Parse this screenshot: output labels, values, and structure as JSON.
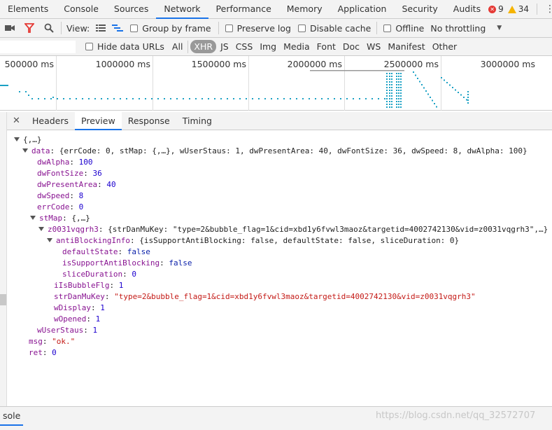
{
  "main_tabs": [
    "Elements",
    "Console",
    "Sources",
    "Network",
    "Performance",
    "Memory",
    "Application",
    "Security",
    "Audits"
  ],
  "status": {
    "errors": "9",
    "warnings": "34"
  },
  "toolbar": {
    "view_label": "View:",
    "group_by_frame": "Group by frame",
    "preserve_log": "Preserve log",
    "disable_cache": "Disable cache",
    "offline": "Offline",
    "throttling": "No throttling"
  },
  "filter": {
    "hide_data_urls": "Hide data URLs",
    "types": [
      "All",
      "XHR",
      "JS",
      "CSS",
      "Img",
      "Media",
      "Font",
      "Doc",
      "WS",
      "Manifest",
      "Other"
    ],
    "active_type": "XHR"
  },
  "overview": {
    "ticks": [
      "500000 ms",
      "1000000 ms",
      "1500000 ms",
      "2000000 ms",
      "2500000 ms",
      "3000000 ms"
    ],
    "bar_color": "#1ba1c4"
  },
  "detail_tabs": [
    "Headers",
    "Preview",
    "Response",
    "Timing"
  ],
  "preview": {
    "root": "{,…}",
    "data_key": "data",
    "data_summary": "{errCode: 0, stMap: {,…}, wUserStaus: 1, dwPresentArea: 40, dwFontSize: 36, dwSpeed: 8, dwAlpha: 100}",
    "dwAlpha_k": "dwAlpha",
    "dwAlpha_v": "100",
    "dwFontSize_k": "dwFontSize",
    "dwFontSize_v": "36",
    "dwPresentArea_k": "dwPresentArea",
    "dwPresentArea_v": "40",
    "dwSpeed_k": "dwSpeed",
    "dwSpeed_v": "8",
    "errCode_k": "errCode",
    "errCode_v": "0",
    "stMap_k": "stMap",
    "stMap_v": "{,…}",
    "z_k": "z0031vqgrh3",
    "z_v": "{strDanMuKey: \"type=2&bubble_flag=1&cid=xbd1y6fvwl3maoz&targetid=4002742130&vid=z0031vqgrh3\",…}",
    "anti_k": "antiBlockingInfo",
    "anti_v": "{isSupportAntiBlocking: false, defaultState: false, sliceDuration: 0}",
    "defaultState_k": "defaultState",
    "defaultState_v": "false",
    "isSupport_k": "isSupportAntiBlocking",
    "isSupport_v": "false",
    "slice_k": "sliceDuration",
    "slice_v": "0",
    "iIsBubble_k": "iIsBubbleFlg",
    "iIsBubble_v": "1",
    "strDan_k": "strDanMuKey",
    "strDan_v": "\"type=2&bubble_flag=1&cid=xbd1y6fvwl3maoz&targetid=4002742130&vid=z0031vqgrh3\"",
    "wDisplay_k": "wDisplay",
    "wDisplay_v": "1",
    "wOpened_k": "wOpened",
    "wOpened_v": "1",
    "wUser_k": "wUserStaus",
    "wUser_v": "1",
    "msg_k": "msg",
    "msg_v": "\"ok.\"",
    "ret_k": "ret",
    "ret_v": "0"
  },
  "bottom": {
    "console_label": "sole",
    "watermark": "https://blog.csdn.net/qq_32572707"
  }
}
